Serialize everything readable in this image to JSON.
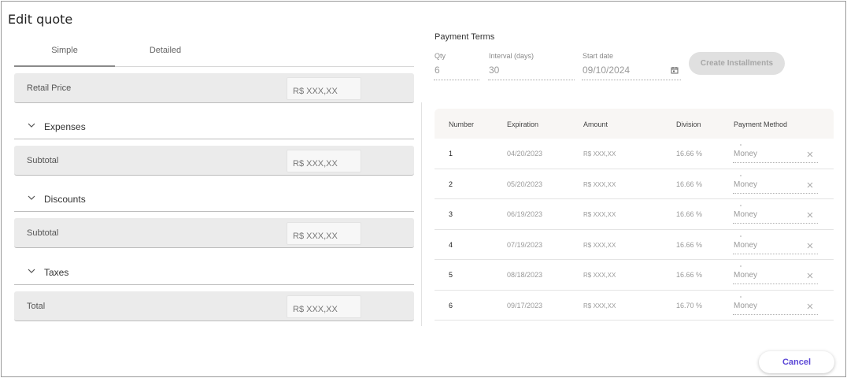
{
  "dialog": {
    "title": "Edit quote"
  },
  "tabs": [
    {
      "label": "Simple",
      "active": true
    },
    {
      "label": "Detailed",
      "active": false
    }
  ],
  "pricing": {
    "retail_price": {
      "label": "Retail Price",
      "value": "R$ XXX,XX"
    },
    "expenses": {
      "label": "Expenses"
    },
    "expenses_subtotal": {
      "label": "Subtotal",
      "value": "R$ XXX,XX"
    },
    "discounts": {
      "label": "Discounts"
    },
    "discounts_subtotal": {
      "label": "Subtotal",
      "value": "R$ XXX,XX"
    },
    "taxes": {
      "label": "Taxes"
    },
    "total": {
      "label": "Total",
      "value": "R$ XXX,XX"
    }
  },
  "payment_terms": {
    "title": "Payment Terms",
    "qty": {
      "label": "Qty",
      "value": "6"
    },
    "interval": {
      "label": "Interval (days)",
      "value": "30"
    },
    "start_date": {
      "label": "Start date",
      "value": "09/10/2024"
    },
    "create_button": "Create Installments"
  },
  "installments": {
    "headers": [
      "Number",
      "Expiration",
      "Amount",
      "Division",
      "Payment Method"
    ],
    "rows": [
      {
        "number": "1",
        "expiration": "04/20/2023",
        "amount": "R$ XXX,XX",
        "division": "16.66 %",
        "method": "Money"
      },
      {
        "number": "2",
        "expiration": "05/20/2023",
        "amount": "R$ XXX,XX",
        "division": "16.66 %",
        "method": "Money"
      },
      {
        "number": "3",
        "expiration": "06/19/2023",
        "amount": "R$ XXX,XX",
        "division": "16.66 %",
        "method": "Money"
      },
      {
        "number": "4",
        "expiration": "07/19/2023",
        "amount": "R$ XXX,XX",
        "division": "16.66 %",
        "method": "Money"
      },
      {
        "number": "5",
        "expiration": "08/18/2023",
        "amount": "R$ XXX,XX",
        "division": "16.66 %",
        "method": "Money"
      },
      {
        "number": "6",
        "expiration": "09/17/2023",
        "amount": "R$ XXX,XX",
        "division": "16.70 %",
        "method": "Money"
      }
    ]
  },
  "footer": {
    "cancel_label": "Cancel"
  },
  "colors": {
    "accent": "#5b47d6",
    "row_bg": "#ebebeb",
    "header_bg": "#f8f6f4"
  },
  "icons": {
    "section_toggle": "chevron-down-icon",
    "date_picker": "calendar-icon",
    "remove": "close-icon"
  }
}
